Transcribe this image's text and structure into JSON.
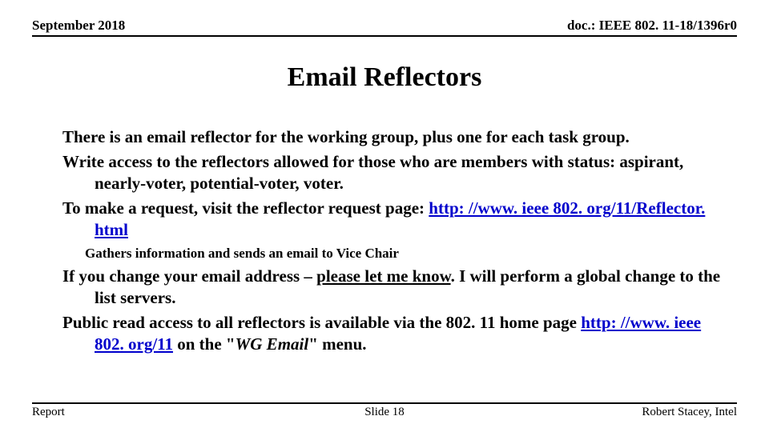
{
  "header": {
    "date": "September 2018",
    "docid": "doc.: IEEE 802. 11-18/1396r0"
  },
  "title": "Email Reflectors",
  "body": {
    "p1": "There is an email reflector for the working group,  plus one for each task group.",
    "p2": "Write access to the reflectors allowed for those who are members with status: aspirant, nearly-voter, potential-voter, voter.",
    "p3": "To make a request, visit the reflector request page:",
    "link1": "http: //www. ieee 802. org/11/Reflector. html",
    "sub1": "Gathers information and sends an email to Vice Chair",
    "p4a": "If you change your email address – ",
    "p4u": "please let me know",
    "p4b": ".  I will perform a global change to the list servers.",
    "p5a": "Public read access to all reflectors is available via the 802. 11 home page ",
    "link2": "http: //www. ieee 802. org/11",
    "p5b": " on the \"",
    "p5i": "WG Email",
    "p5c": "\" menu."
  },
  "footer": {
    "left": "Report",
    "center": "Slide 18",
    "right": "Robert Stacey, Intel"
  }
}
